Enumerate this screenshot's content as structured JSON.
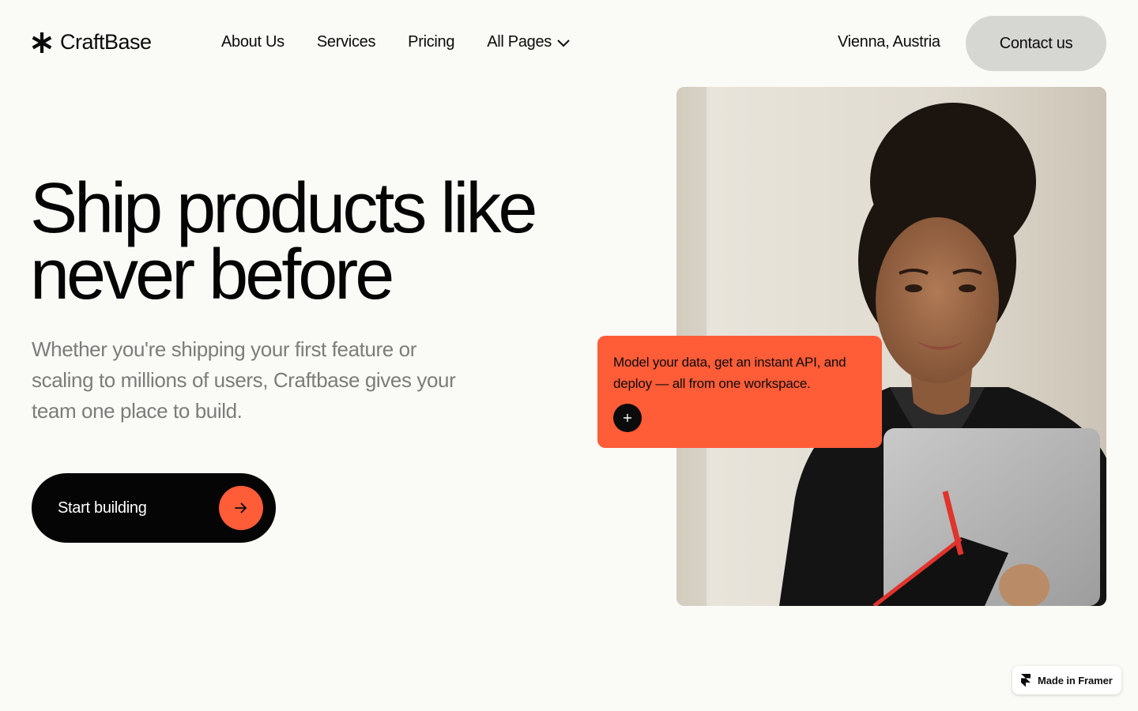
{
  "brand": {
    "name": "CraftBase",
    "logo_icon": "asterisk-icon"
  },
  "nav": {
    "items": [
      {
        "label": "About Us"
      },
      {
        "label": "Services"
      },
      {
        "label": "Pricing"
      },
      {
        "label": "All Pages",
        "icon": "chevron-down-icon"
      }
    ]
  },
  "header": {
    "location": "Vienna, Austria",
    "contact_label": "Contact us"
  },
  "hero": {
    "title_line1": "Ship products like",
    "title_line2": "never before",
    "subtitle": "Whether you're shipping your first feature or scaling to millions of users, Craftbase gives your team one place to build.",
    "cta_label": "Start building",
    "cta_icon": "arrow-right-icon"
  },
  "card": {
    "text": "Model your data, get an instant API, and deploy — all from one workspace.",
    "button_icon": "plus-icon"
  },
  "badge": {
    "label": "Made in Framer",
    "icon": "framer-logo-icon"
  },
  "colors": {
    "background": "#fafaf6",
    "accent": "#ff5c38",
    "text": "#0b0b0b",
    "muted": "#7c7c7a",
    "contact_button": "#d6d6d2"
  }
}
